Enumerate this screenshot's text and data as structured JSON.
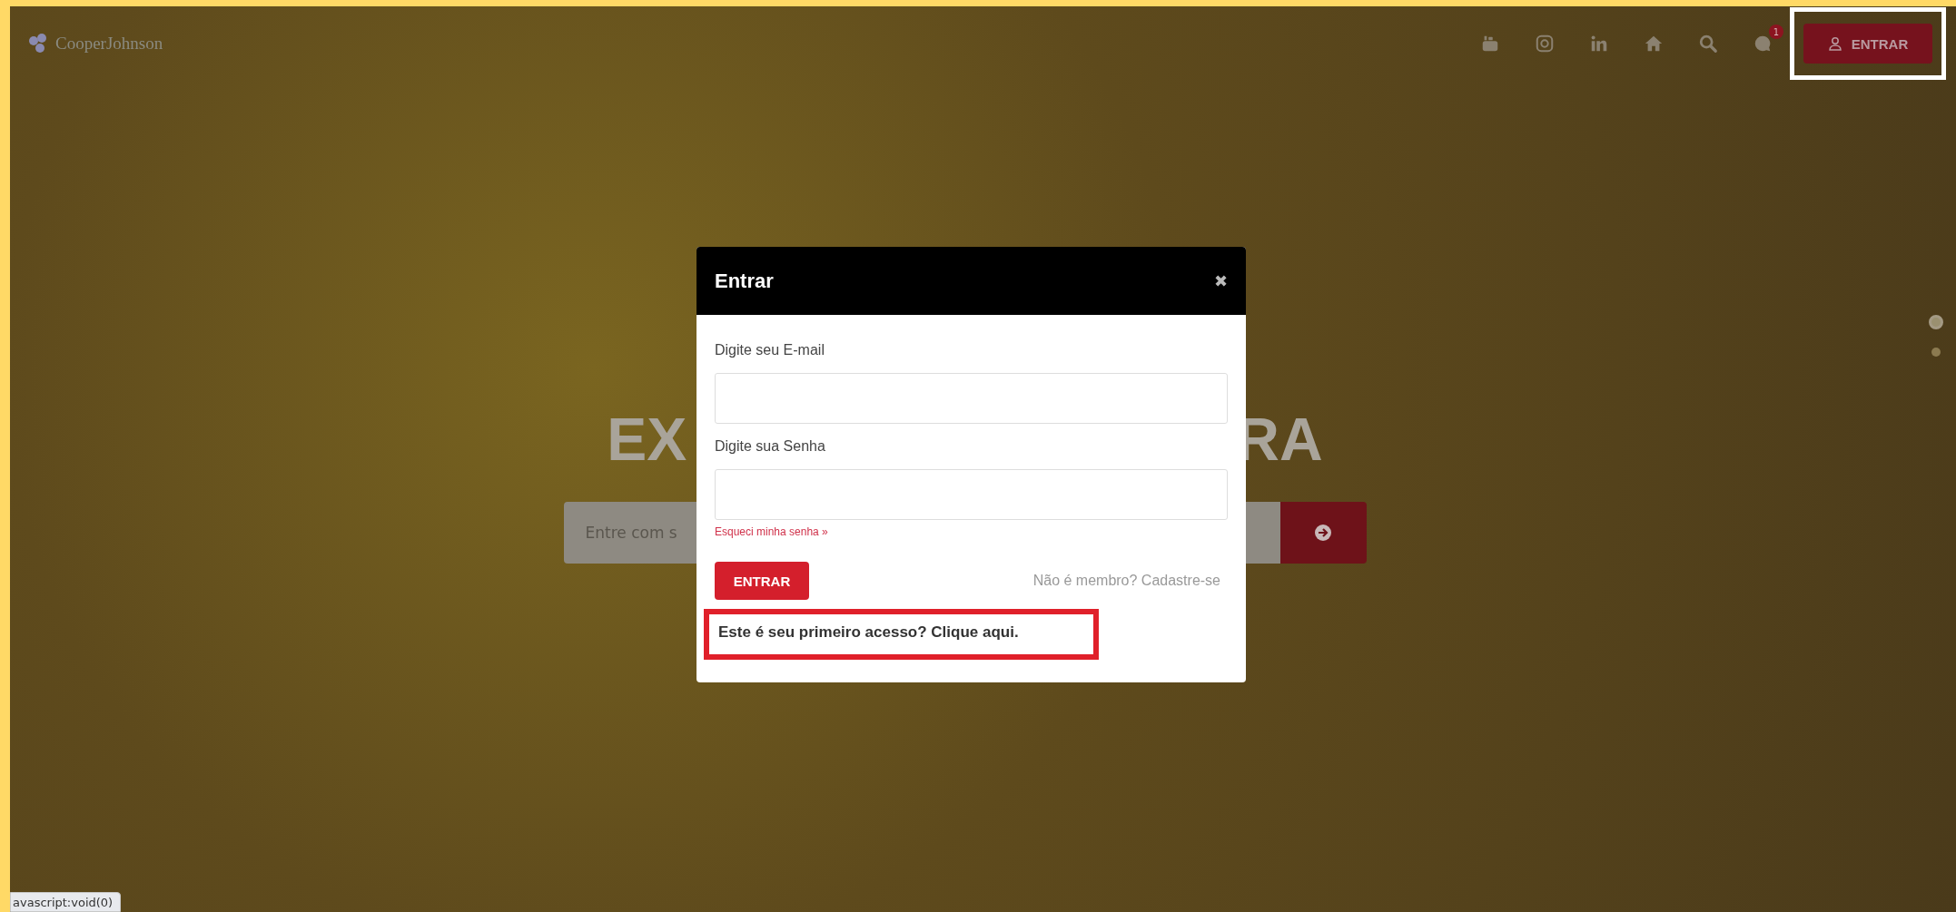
{
  "header": {
    "logo": "CooperJohnson",
    "icons": [
      {
        "kind": "youtube"
      },
      {
        "kind": "instagram"
      },
      {
        "kind": "linkedin"
      },
      {
        "kind": "home"
      },
      {
        "kind": "search"
      },
      {
        "kind": "chat",
        "badge": "1"
      }
    ],
    "login_button": "ENTRAR",
    "login_button_highlighted": true
  },
  "hero": {
    "title_left": "EX",
    "title_right": "RA",
    "search": {
      "placeholder": "Entre com s"
    }
  },
  "slider_dots": [
    {
      "selected": true
    },
    {
      "selected": false
    }
  ],
  "modal": {
    "title": "Entrar",
    "close": "✖",
    "fields": [
      {
        "label": "Digite seu E-mail"
      },
      {
        "label": "Digite sua Senha"
      }
    ],
    "forgot_link": "Esqueci minha senha »",
    "submit": "ENTRAR",
    "signup": "Não é membro? Cadastre-se",
    "first_access": "Este é seu primeiro acesso? Clique aqui.",
    "first_access_highlighted": true
  },
  "status_bar": "avascript:void(0)"
}
